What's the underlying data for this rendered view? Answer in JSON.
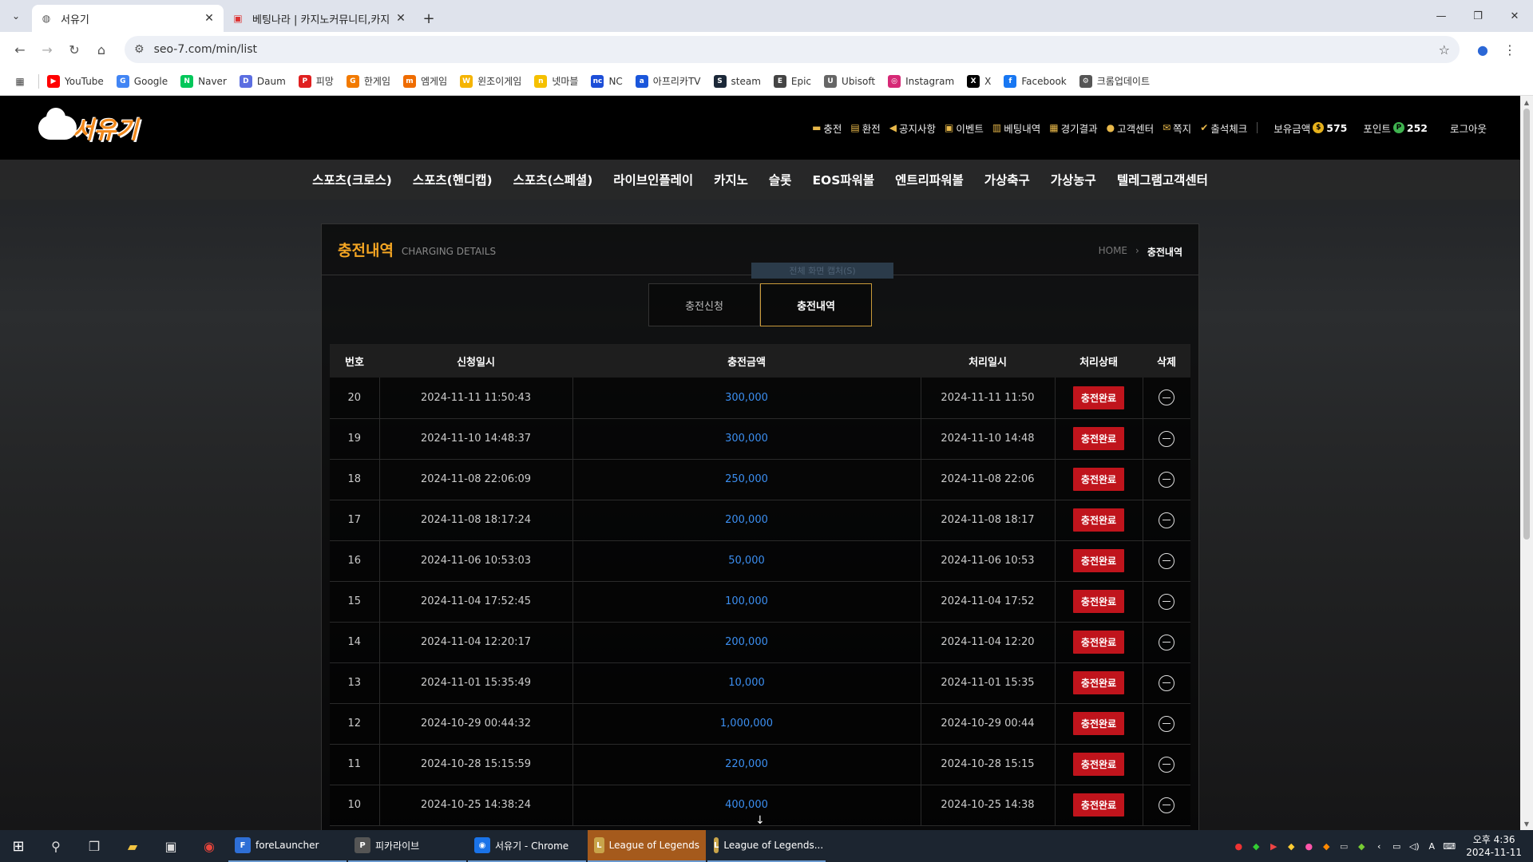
{
  "browser": {
    "tabs": [
      {
        "title": "서유기",
        "active": true
      },
      {
        "title": "베팅나라 | 카지노커뮤니티,카지",
        "active": false
      }
    ],
    "url": "seo-7.com/min/list",
    "bookmarks": [
      {
        "label": "YouTube",
        "color": "#ff0000",
        "glyph": "▶"
      },
      {
        "label": "Google",
        "color": "#4285f4",
        "glyph": "G"
      },
      {
        "label": "Naver",
        "color": "#03c75a",
        "glyph": "N"
      },
      {
        "label": "Daum",
        "color": "#5b6ee1",
        "glyph": "D"
      },
      {
        "label": "피망",
        "color": "#e02020",
        "glyph": "P"
      },
      {
        "label": "한게임",
        "color": "#f27a00",
        "glyph": "G"
      },
      {
        "label": "엠게임",
        "color": "#ef6c00",
        "glyph": "m"
      },
      {
        "label": "윈조이게임",
        "color": "#f5b400",
        "glyph": "W"
      },
      {
        "label": "넷마블",
        "color": "#f5c000",
        "glyph": "n"
      },
      {
        "label": "NC",
        "color": "#1d4ed8",
        "glyph": "nc"
      },
      {
        "label": "아프리카TV",
        "color": "#1a56db",
        "glyph": "a"
      },
      {
        "label": "steam",
        "color": "#1b2838",
        "glyph": "S"
      },
      {
        "label": "Epic",
        "color": "#444444",
        "glyph": "E"
      },
      {
        "label": "Ubisoft",
        "color": "#666666",
        "glyph": "U"
      },
      {
        "label": "Instagram",
        "color": "#d62976",
        "glyph": "◎"
      },
      {
        "label": "X",
        "color": "#000000",
        "glyph": "X"
      },
      {
        "label": "Facebook",
        "color": "#1877f2",
        "glyph": "f"
      },
      {
        "label": "크롬업데이트",
        "color": "#555555",
        "glyph": "⚙"
      }
    ]
  },
  "site": {
    "logo_text": "서유기",
    "top_menu": [
      {
        "label": "충전",
        "icon": "wallet-icon",
        "glyph": "▬"
      },
      {
        "label": "환전",
        "icon": "exchange-icon",
        "glyph": "▤"
      },
      {
        "label": "공지사항",
        "icon": "megaphone-icon",
        "glyph": "◀"
      },
      {
        "label": "이벤트",
        "icon": "gift-icon",
        "glyph": "▣"
      },
      {
        "label": "베팅내역",
        "icon": "receipt-icon",
        "glyph": "▥"
      },
      {
        "label": "경기결과",
        "icon": "result-icon",
        "glyph": "▦"
      },
      {
        "label": "고객센터",
        "icon": "support-icon",
        "glyph": "●"
      },
      {
        "label": "쪽지",
        "icon": "message-icon",
        "glyph": "✉"
      },
      {
        "label": "출석체크",
        "icon": "attendance-icon",
        "glyph": "✔"
      }
    ],
    "balance_label": "보유금액",
    "balance_value": "575",
    "point_label": "포인트",
    "point_value": "252",
    "logout_label": "로그아웃",
    "main_nav": [
      "스포츠(크로스)",
      "스포츠(핸디캡)",
      "스포츠(스페셜)",
      "라이브인플레이",
      "카지노",
      "슬롯",
      "EOS파워볼",
      "엔트리파워볼",
      "가상축구",
      "가상농구",
      "텔레그램고객센터"
    ]
  },
  "panel": {
    "title": "충전내역",
    "subtitle": "CHARGING DETAILS",
    "breadcrumb_home": "HOME",
    "breadcrumb_current": "충전내역",
    "tooltip_text": "전체 화면 캡처(S)",
    "tabs": [
      {
        "label": "충전신청",
        "active": false
      },
      {
        "label": "충전내역",
        "active": true
      }
    ],
    "table": {
      "headers": [
        "번호",
        "신청일시",
        "충전금액",
        "처리일시",
        "처리상태",
        "삭제"
      ],
      "rows": [
        {
          "no": "20",
          "requested": "2024-11-11 11:50:43",
          "amount": "300,000",
          "processed": "2024-11-11 11:50",
          "status": "충전완료"
        },
        {
          "no": "19",
          "requested": "2024-11-10 14:48:37",
          "amount": "300,000",
          "processed": "2024-11-10 14:48",
          "status": "충전완료"
        },
        {
          "no": "18",
          "requested": "2024-11-08 22:06:09",
          "amount": "250,000",
          "processed": "2024-11-08 22:06",
          "status": "충전완료"
        },
        {
          "no": "17",
          "requested": "2024-11-08 18:17:24",
          "amount": "200,000",
          "processed": "2024-11-08 18:17",
          "status": "충전완료"
        },
        {
          "no": "16",
          "requested": "2024-11-06 10:53:03",
          "amount": "50,000",
          "processed": "2024-11-06 10:53",
          "status": "충전완료"
        },
        {
          "no": "15",
          "requested": "2024-11-04 17:52:45",
          "amount": "100,000",
          "processed": "2024-11-04 17:52",
          "status": "충전완료"
        },
        {
          "no": "14",
          "requested": "2024-11-04 12:20:17",
          "amount": "200,000",
          "processed": "2024-11-04 12:20",
          "status": "충전완료"
        },
        {
          "no": "13",
          "requested": "2024-11-01 15:35:49",
          "amount": "10,000",
          "processed": "2024-11-01 15:35",
          "status": "충전완료"
        },
        {
          "no": "12",
          "requested": "2024-10-29 00:44:32",
          "amount": "1,000,000",
          "processed": "2024-10-29 00:44",
          "status": "충전완료"
        },
        {
          "no": "11",
          "requested": "2024-10-28 15:15:59",
          "amount": "220,000",
          "processed": "2024-10-28 15:15",
          "status": "충전완료"
        },
        {
          "no": "10",
          "requested": "2024-10-25 14:38:24",
          "amount": "400,000",
          "processed": "2024-10-25 14:38",
          "status": "충전완료"
        }
      ]
    }
  },
  "taskbar": {
    "apps": [
      {
        "label": "foreLauncher",
        "glyph": "F",
        "color": "#2e6fd6",
        "highlight": false
      },
      {
        "label": "피카라이브",
        "glyph": "P",
        "color": "#555555",
        "highlight": false
      },
      {
        "label": "서유기 - Chrome",
        "glyph": "◉",
        "color": "#1a73e8",
        "highlight": false
      },
      {
        "label": "League of Legends",
        "glyph": "L",
        "color": "#c8a44a",
        "highlight": true
      },
      {
        "label": "League of Legends...",
        "glyph": "L",
        "color": "#c8a44a",
        "highlight": false
      }
    ],
    "time": "오후 4:36",
    "date": "2024-11-11"
  }
}
